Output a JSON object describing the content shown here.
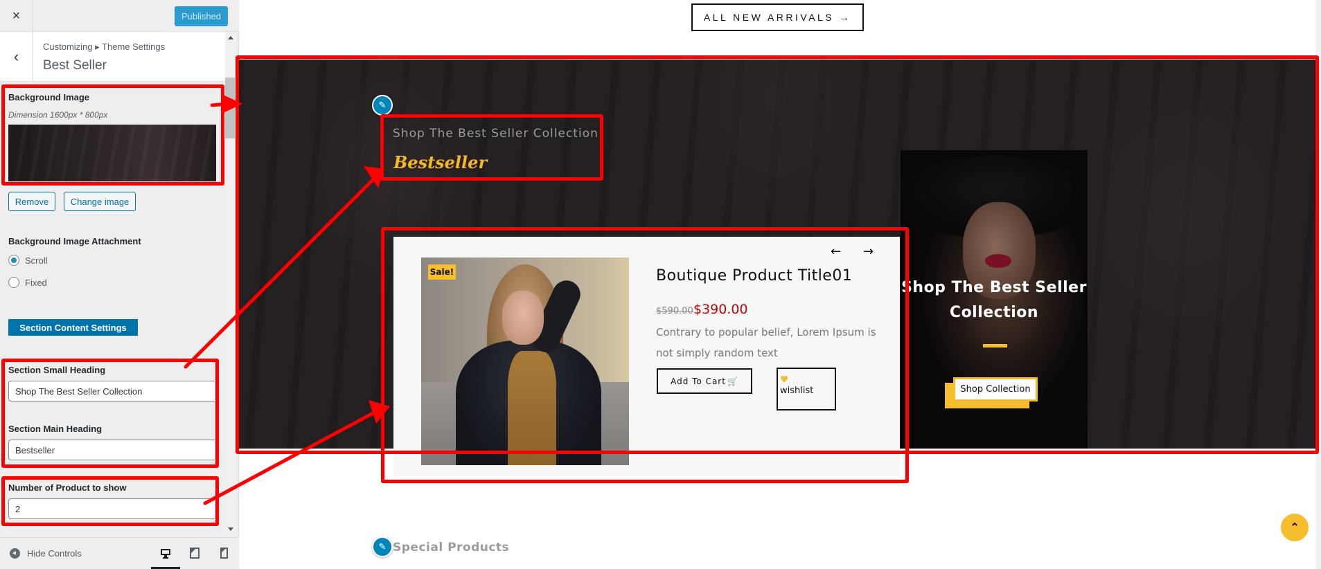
{
  "customizer": {
    "close_icon": "×",
    "publish_label": "Published",
    "back_icon": "‹",
    "breadcrumb": "Customizing ▸ Theme Settings",
    "section_title": "Best Seller",
    "background_image": {
      "label": "Background Image",
      "description": "Dimension 1600px * 800px",
      "remove_label": "Remove",
      "change_label": "Change image"
    },
    "attachment": {
      "label": "Background Image Attachment",
      "options": [
        {
          "label": "Scroll",
          "selected": true
        },
        {
          "label": "Fixed",
          "selected": false
        }
      ]
    },
    "content_settings_label": "Section Content Settings",
    "small_heading": {
      "label": "Section Small Heading",
      "value": "Shop The Best Seller Collection"
    },
    "main_heading": {
      "label": "Section Main Heading",
      "value": "Bestseller"
    },
    "product_count": {
      "label": "Number of Product to show",
      "value": "2"
    },
    "hide_controls_label": "Hide Controls",
    "devices": [
      "desktop-icon",
      "tablet-icon",
      "mobile-icon"
    ],
    "active_device": "desktop"
  },
  "preview": {
    "arrivals_button": "ALL NEW ARRIVALS →",
    "bestseller": {
      "small_heading": "Shop The Best Seller Collection",
      "main_heading": "Bestseller",
      "prev_arrow": "←",
      "next_arrow": "→",
      "product": {
        "badge": "Sale!",
        "title": "Boutique Product Title01",
        "old_price": "$590.00",
        "new_price": "$390.00",
        "description": "Contrary to popular belief, Lorem Ipsum is not simply random text",
        "add_to_cart": "Add To Cart",
        "cart_icon": "🛒",
        "wishlist_icon": "♥",
        "wishlist": "wishlist"
      },
      "promo": {
        "title": "Shop The Best Seller Collection",
        "button": "Shop Collection"
      }
    },
    "special_heading": "Special Products",
    "edit_icon": "✎",
    "back_to_top_icon": "⌃"
  },
  "colors": {
    "accent_yellow": "#f6bd2d",
    "wp_blue": "#0073aa",
    "price_red": "#cc0000",
    "annotation_red": "#ff0000"
  }
}
